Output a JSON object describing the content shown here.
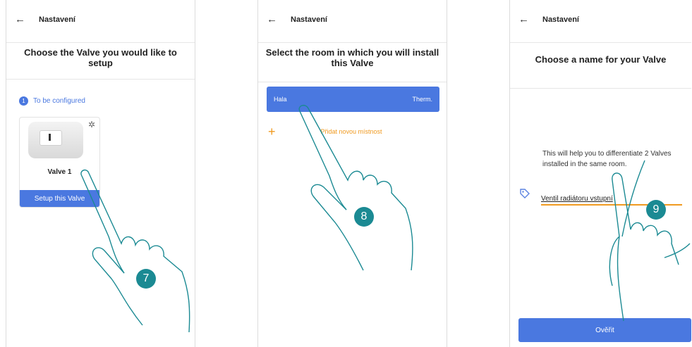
{
  "screens": [
    {
      "back_glyph": "←",
      "title": "Nastavení",
      "heading": "Choose the Valve you would like to setup",
      "status_number": "1",
      "status_text": "To be configured",
      "device_name": "Valve 1",
      "setup_button": "Setup this Valve",
      "settings_icon": "gear-icon",
      "step_marker": "7"
    },
    {
      "back_glyph": "←",
      "title": "Nastavení",
      "heading": "Select the room in which you will install this Valve",
      "room_name": "Hala",
      "room_type": "Therm.",
      "add_glyph": "+",
      "add_room": "Přidat novou místnost",
      "step_marker": "8"
    },
    {
      "back_glyph": "←",
      "title": "Nastavení",
      "heading": "Choose a name for your Valve",
      "description": "This will help you to differentiate 2 Valves installed in the same room.",
      "name_value": "Ventil radiátoru vstupní",
      "tag_icon": "tag-icon",
      "verify_button": "Ověřit",
      "step_marker": "9"
    }
  ],
  "colors": {
    "accent_blue": "#4a78e0",
    "orange": "#f09a20",
    "teal": "#1b8a93"
  }
}
